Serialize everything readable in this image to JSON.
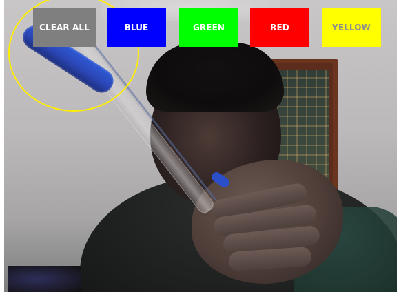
{
  "toolbar": {
    "clear_all_label": "CLEAR ALL",
    "blue_label": "BLUE",
    "green_label": "GREEN",
    "red_label": "RED",
    "yellow_label": "YELLOW"
  },
  "colors": {
    "clear_all": "#7f7f7f",
    "blue": "#0000ff",
    "green": "#00ff00",
    "red": "#ff0000",
    "yellow": "#ffff00",
    "cursor_ring": "#ffee00"
  }
}
